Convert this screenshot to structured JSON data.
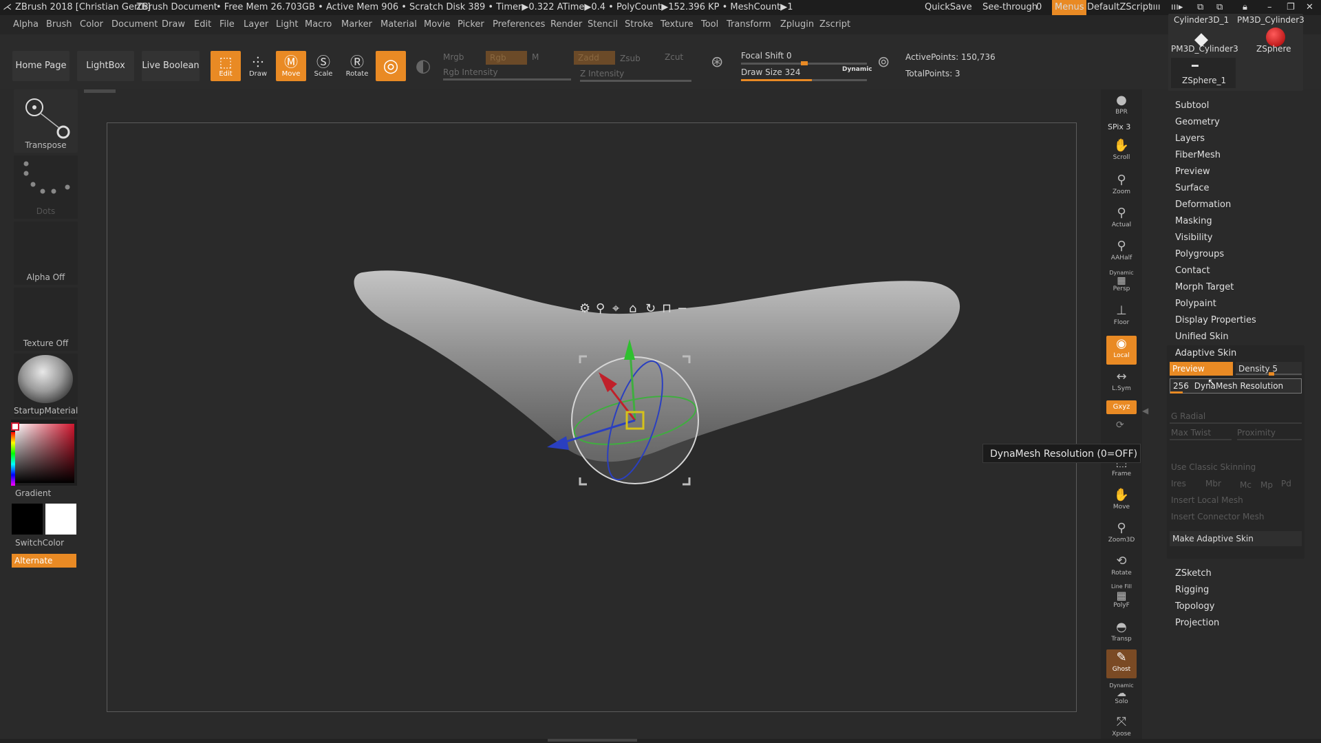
{
  "titlebar": {
    "app": "ZBrush 2018 [Christian Gerth]",
    "document": "ZBrush Document",
    "stats": "• Free Mem 26.703GB • Active Mem 906 • Scratch Disk 389 • Timer▶0.322 ATime▶0.4 • PolyCount▶152.396 KP • MeshCount▶1",
    "quicksave": "QuickSave",
    "seethrough_label": "See-through",
    "seethrough_value": "0",
    "menus": "Menus",
    "script": "DefaultZScript"
  },
  "menubar": [
    "Alpha",
    "Brush",
    "Color",
    "Document",
    "Draw",
    "Edit",
    "File",
    "Layer",
    "Light",
    "Macro",
    "Marker",
    "Material",
    "Movie",
    "Picker",
    "Preferences",
    "Render",
    "Stencil",
    "Stroke",
    "Texture",
    "Tool",
    "Transform",
    "Zplugin",
    "Zscript"
  ],
  "toolbar": {
    "home": "Home Page",
    "lightbox": "LightBox",
    "liveboolean": "Live Boolean",
    "edit": "Edit",
    "draw": "Draw",
    "move": "Move",
    "scale": "Scale",
    "rotate": "Rotate",
    "mrgb": "Mrgb",
    "rgb": "Rgb",
    "m": "M",
    "rgb_intensity": "Rgb Intensity",
    "zadd": "Zadd",
    "zsub": "Zsub",
    "zcut": "Zcut",
    "z_intensity": "Z Intensity",
    "focal_shift": "Focal Shift 0",
    "draw_size": "Draw Size 324",
    "dynamic": "Dynamic",
    "active_points": "ActivePoints: 150,736",
    "total_points": "TotalPoints: 3"
  },
  "leftpanel": {
    "transpose": "Transpose",
    "dots": "Dots",
    "alpha": "Alpha Off",
    "texture": "Texture Off",
    "material": "StartupMaterial",
    "gradient": "Gradient",
    "switchcolor": "SwitchColor",
    "alternate": "Alternate"
  },
  "gizmo_toolbar": [
    "gear-icon",
    "pin-icon",
    "location-icon",
    "home-icon",
    "reset-icon",
    "lock-icon",
    "minus-icon"
  ],
  "rightdock": {
    "bpr": "BPR",
    "spix": "SPix 3",
    "scroll": "Scroll",
    "zoom": "Zoom",
    "actual": "Actual",
    "aahalf": "AAHalf",
    "dynamic": "Dynamic",
    "persp": "Persp",
    "floor": "Floor",
    "local": "Local",
    "lsym": "L.Sym",
    "xyz": "Gxyz",
    "frame": "Frame",
    "move": "Move",
    "zoom3d": "Zoom3D",
    "rotate": "Rotate",
    "linefill": "Line Fill",
    "polyf": "PolyF",
    "transp": "Transp",
    "ghost": "Ghost",
    "dynamic2": "Dynamic",
    "solo": "Solo",
    "xpose": "Xpose"
  },
  "subtools": [
    {
      "label": "Cylinder3D_1"
    },
    {
      "label": "PM3D_Cylinder3"
    },
    {
      "label": "PM3D_Cylinder3"
    },
    {
      "label": "ZSphere"
    },
    {
      "label": "ZSphere_1"
    }
  ],
  "rightpanel": {
    "sections": [
      "Subtool",
      "Geometry",
      "Layers",
      "FiberMesh",
      "Preview",
      "Surface",
      "Deformation",
      "Masking",
      "Visibility",
      "Polygroups",
      "Contact",
      "Morph Target",
      "Polypaint",
      "Display Properties",
      "Unified Skin"
    ],
    "adaptive_skin": "Adaptive Skin",
    "preview": "Preview",
    "density": "Density 5",
    "resolution_value": "256",
    "resolution_label": "DynaMesh Resolution",
    "g_radial": "G Radial",
    "max_twist": "Max Twist",
    "proximity": "Proximity",
    "classic": "Use Classic Skinning",
    "ires": "Ires",
    "mbr": "Mbr",
    "mc": "Mc",
    "mp": "Mp",
    "pd": "Pd",
    "insert_local": "Insert Local Mesh",
    "insert_connector": "Insert Connector Mesh",
    "make": "Make Adaptive Skin",
    "bottom_sections": [
      "ZSketch",
      "Rigging",
      "Topology",
      "Projection"
    ]
  },
  "tooltip": "DynaMesh Resolution (0=OFF)",
  "colors": {
    "accent": "#e98a24",
    "bg": "#2a2a2a",
    "mesh": "#8f8f8f"
  }
}
